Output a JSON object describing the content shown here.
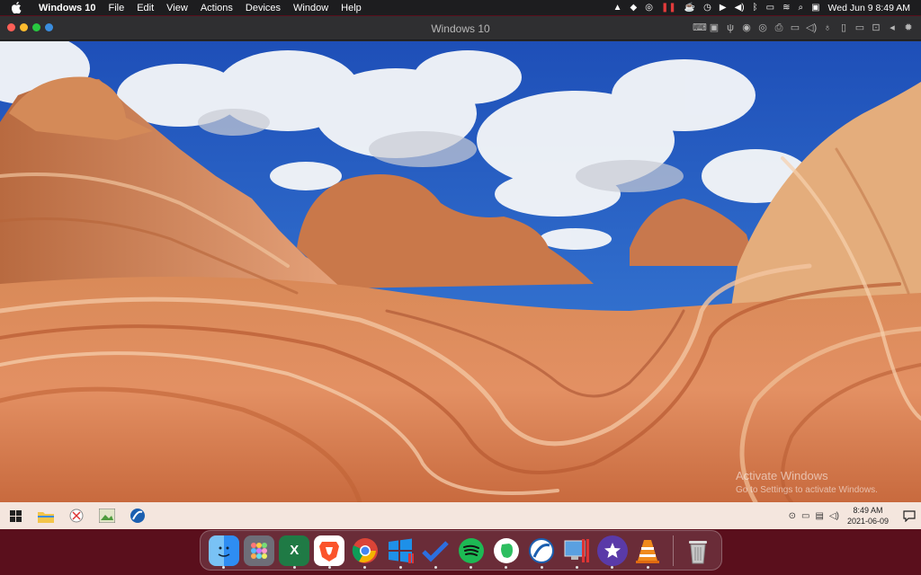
{
  "menubar": {
    "app_name": "Windows 10",
    "items": [
      "File",
      "Edit",
      "View",
      "Actions",
      "Devices",
      "Window",
      "Help"
    ],
    "status_icons": [
      "vlc-icon",
      "evernote-icon",
      "vpn-icon",
      "parallels-icon",
      "coffee-icon",
      "clock-icon",
      "play-icon",
      "volume-icon",
      "bluetooth-icon",
      "battery-icon",
      "wifi-icon",
      "search-icon",
      "control-center-icon"
    ],
    "clock": "Wed Jun 9  8:49 AM"
  },
  "window": {
    "title": "Windows 10",
    "tool_icons": [
      "keyboard-icon",
      "chip-icon",
      "usb-icon",
      "cd-icon",
      "disk-icon",
      "printer-icon",
      "folder-icon",
      "volume-icon",
      "mic-icon",
      "phone-icon",
      "camera-icon",
      "share-icon",
      "arrow-left-icon",
      "gear-icon"
    ]
  },
  "desktop": {
    "activate_title": "Activate Windows",
    "activate_sub": "Go to Settings to activate Windows."
  },
  "taskbar": {
    "time": "8:49 AM",
    "date": "2021-06-09",
    "apps": [
      "start-icon",
      "file-explorer-icon",
      "snipping-tool-icon",
      "photo-app-icon",
      "browser-icon"
    ],
    "tray_icons": [
      "meet-icon",
      "battery-icon",
      "network-icon",
      "volume-icon"
    ]
  },
  "dock": {
    "apps": [
      {
        "name": "Finder",
        "color": "#2e8df2"
      },
      {
        "name": "Launchpad",
        "color": "#7c7c88"
      },
      {
        "name": "Microsoft Excel",
        "color": "#1f7a45"
      },
      {
        "name": "Brave",
        "color": "#ffffff"
      },
      {
        "name": "Google Chrome",
        "color": "#ffffff"
      },
      {
        "name": "Windows 10",
        "color": "#1e90e8"
      },
      {
        "name": "Microsoft To Do",
        "color": "#2c6fe0"
      },
      {
        "name": "Spotify",
        "color": "#1db954"
      },
      {
        "name": "Evernote",
        "color": "#ffffff"
      },
      {
        "name": "Safari Connect",
        "color": "#1b5fb0"
      },
      {
        "name": "Parallels Desktop",
        "color": "#5a8dcc"
      },
      {
        "name": "iMovie",
        "color": "#6a3fb0"
      },
      {
        "name": "VLC",
        "color": "#f08a1c"
      },
      {
        "name": "Trash",
        "color": "#9a9a9a"
      }
    ]
  }
}
